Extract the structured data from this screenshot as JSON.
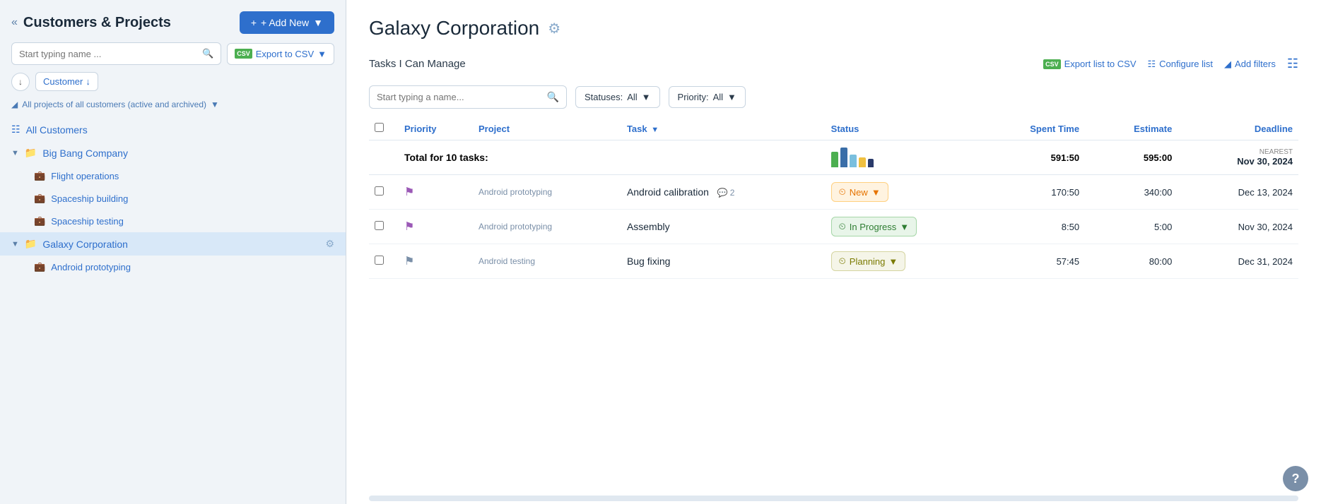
{
  "sidebar": {
    "title": "Customers & Projects",
    "back_arrows": "<<",
    "add_new_label": "+ Add New",
    "search_placeholder": "Start typing name ...",
    "export_csv_label": "Export to CSV",
    "customer_filter_label": "Customer",
    "projects_filter_label": "All projects of all customers (active and archived)",
    "all_customers_label": "All Customers",
    "customers": [
      {
        "name": "Big Bang Company",
        "expanded": true,
        "projects": [
          {
            "name": "Flight operations"
          },
          {
            "name": "Spaceship building"
          },
          {
            "name": "Spaceship testing"
          }
        ]
      },
      {
        "name": "Galaxy Corporation",
        "expanded": true,
        "active": true,
        "projects": [
          {
            "name": "Android prototyping"
          }
        ]
      }
    ]
  },
  "main": {
    "title": "Galaxy Corporation",
    "section_label": "Tasks I Can Manage",
    "export_list_label": "Export list to CSV",
    "configure_list_label": "Configure list",
    "add_filters_label": "Add filters",
    "search_placeholder": "Start typing a name...",
    "statuses_label": "Statuses:",
    "statuses_value": "All",
    "priority_label": "Priority:",
    "priority_value": "All",
    "table": {
      "columns": [
        "Priority",
        "Project",
        "Task",
        "Status",
        "Spent Time",
        "Estimate",
        "Deadline"
      ],
      "total_row": {
        "label": "Total for 10 tasks:",
        "spent_time": "591:50",
        "estimate": "595:00",
        "nearest_label": "NEAREST",
        "deadline": "Nov 30, 2024",
        "chart_bars": [
          {
            "color": "#4caf50",
            "height": 22,
            "width": 10
          },
          {
            "color": "#3a6ea8",
            "height": 28,
            "width": 10
          },
          {
            "color": "#7abfde",
            "height": 18,
            "width": 10
          },
          {
            "color": "#f0c040",
            "height": 14,
            "width": 10
          },
          {
            "color": "#2a3a6a",
            "height": 12,
            "width": 8
          }
        ]
      },
      "rows": [
        {
          "priority_color": "#9b59b6",
          "project": "Android prototyping",
          "task": "Android calibration",
          "comments": "2",
          "status": "New",
          "status_class": "status-new",
          "spent_time": "170:50",
          "estimate": "340:00",
          "deadline": "Dec 13, 2024"
        },
        {
          "priority_color": "#9b59b6",
          "project": "Android prototyping",
          "task": "Assembly",
          "comments": "",
          "status": "In Progress",
          "status_class": "status-inprogress",
          "spent_time": "8:50",
          "estimate": "5:00",
          "deadline": "Nov 30, 2024"
        },
        {
          "priority_color": "#7a8fa8",
          "project": "Android testing",
          "task": "Bug fixing",
          "comments": "",
          "status": "Planning",
          "status_class": "status-planning",
          "spent_time": "57:45",
          "estimate": "80:00",
          "deadline": "Dec 31, 2024"
        }
      ]
    }
  }
}
